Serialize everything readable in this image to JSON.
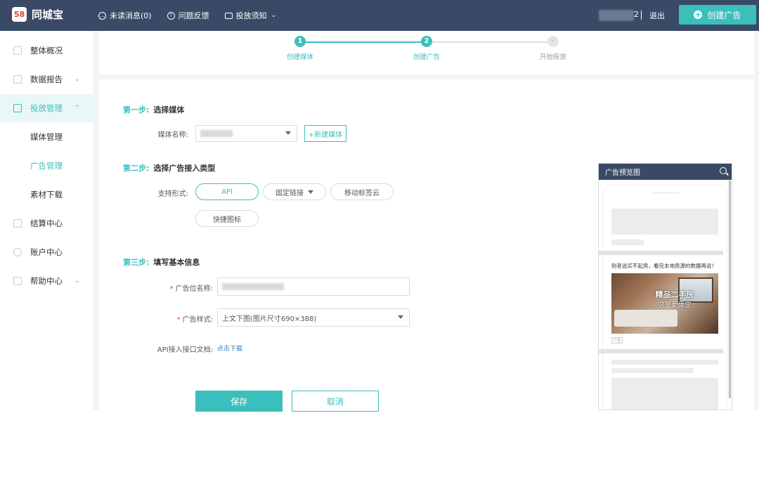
{
  "app": {
    "logo_badge": "58",
    "logo_text": "同城宝"
  },
  "topnav": {
    "unread": "未读消息(0)",
    "feedback": "问题反馈",
    "guide": "投放须知",
    "user_suffix": "2",
    "logout": "退出",
    "create_ad": "创建广告"
  },
  "sidebar": {
    "items": [
      {
        "label": "整体概况"
      },
      {
        "label": "数据报告"
      },
      {
        "label": "投放管理"
      },
      {
        "label": "媒体管理"
      },
      {
        "label": "广告管理"
      },
      {
        "label": "素材下载"
      },
      {
        "label": "结算中心"
      },
      {
        "label": "账户中心"
      },
      {
        "label": "帮助中心"
      }
    ]
  },
  "steps": [
    {
      "num": "1",
      "label": "创建媒体",
      "state": "done"
    },
    {
      "num": "2",
      "label": "创建广告",
      "state": "current"
    },
    {
      "num": "✓",
      "label": "开始投放",
      "state": "pending"
    }
  ],
  "form": {
    "step1": {
      "num": "第一步:",
      "title": "选择媒体"
    },
    "media_label": "媒体名称:",
    "new_media": "+新建媒体",
    "step2": {
      "num": "第二步:",
      "title": "选择广告接入类型"
    },
    "support_label": "支持形式:",
    "types": [
      "API",
      "固定链接",
      "移动标签云",
      "快捷图标"
    ],
    "step3": {
      "num": "第三步:",
      "title": "填写基本信息"
    },
    "ad_name_label": "广告位名称:",
    "ad_style_label": "广告样式:",
    "ad_style_value": "上文下图(图片尺寸690×388)",
    "api_doc_label": "API接入接口文档:",
    "api_doc_link": "点击下载",
    "save": "保存",
    "cancel": "取消"
  },
  "preview": {
    "title": "广告预览图",
    "ad_text": "别老说买不起房，看完本地房源的数据再说！",
    "image_title": "精品二手房",
    "image_subtitle": "这里更便宜",
    "tag": "广告"
  },
  "colors": {
    "accent": "#3abfbd",
    "header": "#3a4a66",
    "link": "#2f7fc1",
    "required": "#e8412c"
  }
}
